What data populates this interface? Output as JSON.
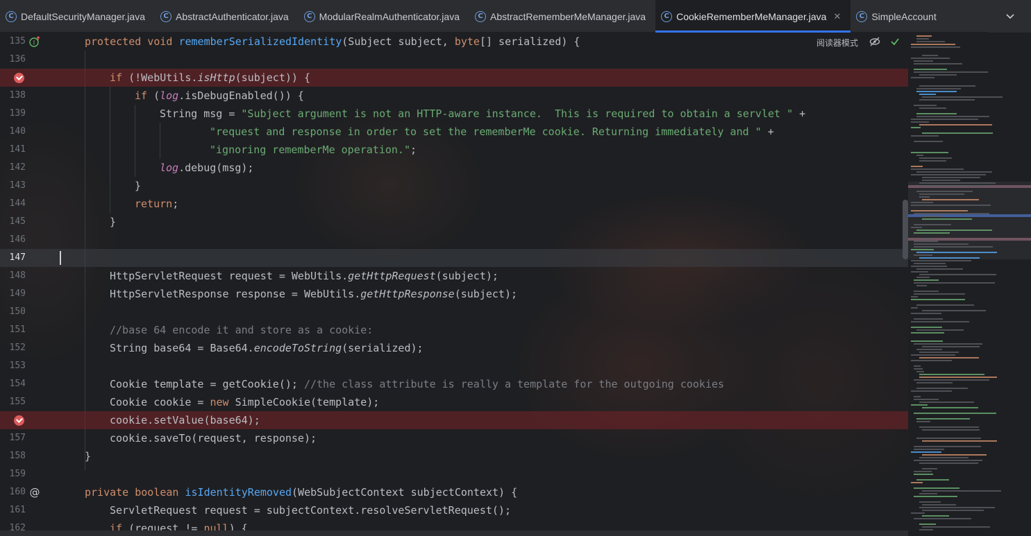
{
  "tabs": [
    {
      "label": "DefaultSecurityManager.java",
      "active": false
    },
    {
      "label": "AbstractAuthenticator.java",
      "active": false
    },
    {
      "label": "ModularRealmAuthenticator.java",
      "active": false
    },
    {
      "label": "AbstractRememberMeManager.java",
      "active": false
    },
    {
      "label": "CookieRememberMeManager.java",
      "active": true
    },
    {
      "label": "SimpleAccount",
      "active": false
    }
  ],
  "reader_mode_label": "阅读器模式",
  "line_numbers": [
    "135",
    "136",
    "137",
    "138",
    "139",
    "140",
    "141",
    "142",
    "143",
    "144",
    "145",
    "146",
    "147",
    "148",
    "149",
    "150",
    "151",
    "152",
    "153",
    "154",
    "155",
    "156",
    "157",
    "158",
    "159",
    "160",
    "161",
    "162"
  ],
  "code": {
    "l135": {
      "a": "protected void ",
      "b": "rememberSerializedIdentity",
      "c": "(Subject subject, ",
      "d": "byte",
      "e": "[] serialized) {"
    },
    "l137": {
      "a": "if ",
      "b": "(!WebUtils.",
      "c": "isHttp",
      "d": "(subject)) {"
    },
    "l138": {
      "a": "if ",
      "b": "(",
      "c": "log",
      "d": ".isDebugEnabled()) {"
    },
    "l139": {
      "a": "String msg = ",
      "b": "\"Subject argument is not an HTTP-aware instance.  This is required to obtain a servlet \"",
      "c": " +"
    },
    "l140": {
      "a": "\"request and response in order to set the rememberMe cookie. Returning immediately and \"",
      "b": " +"
    },
    "l141": {
      "a": "\"ignoring rememberMe operation.\"",
      "b": ";"
    },
    "l142": {
      "a": "log",
      "b": ".debug(msg);"
    },
    "l143": {
      "a": "}"
    },
    "l144": {
      "a": "return",
      "b": ";"
    },
    "l145": {
      "a": "}"
    },
    "l148": {
      "a": "HttpServletRequest request = WebUtils.",
      "b": "getHttpRequest",
      "c": "(subject);"
    },
    "l149": {
      "a": "HttpServletResponse response = WebUtils.",
      "b": "getHttpResponse",
      "c": "(subject);"
    },
    "l151": {
      "a": "//base 64 encode it and store as a cookie:"
    },
    "l152": {
      "a": "String base64 = Base64.",
      "b": "encodeToString",
      "c": "(serialized);"
    },
    "l154": {
      "a": "Cookie template = getCookie(); ",
      "b": "//the class attribute is really a template for the outgoing cookies"
    },
    "l155": {
      "a": "Cookie cookie = ",
      "b": "new ",
      "c": "SimpleCookie(template);"
    },
    "l156": {
      "a": "cookie.setValue(base64);"
    },
    "l157": {
      "a": "cookie.saveTo(request, response);"
    },
    "l158": {
      "a": "}"
    },
    "l160": {
      "a": "private boolean ",
      "b": "isIdentityRemoved",
      "c": "(WebSubjectContext subjectContext) {"
    },
    "l161": {
      "a": "ServletRequest request = subjectContext.resolveServletRequest();"
    },
    "l162": {
      "a": "if ",
      "b": "(request != ",
      "c": "null",
      "d": ") {"
    }
  },
  "colors": {
    "keyword": "#cf8e6d",
    "function": "#56a8f5",
    "string": "#6aab73",
    "comment": "#7a7e85",
    "field": "#c77dbb",
    "breakpoint": "#db5c5c",
    "accent": "#3574f0"
  }
}
